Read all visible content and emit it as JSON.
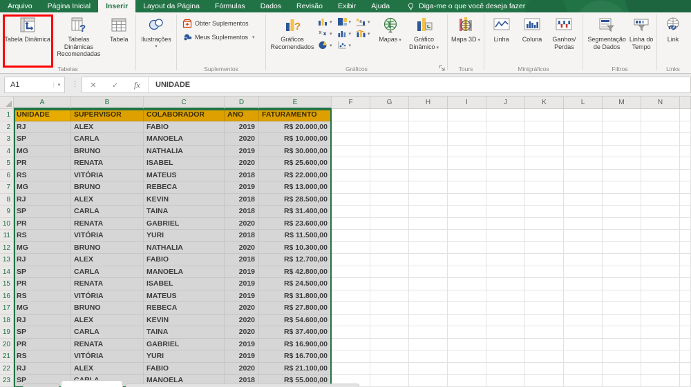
{
  "tabs": {
    "items": [
      {
        "label": "Arquivo",
        "active": false
      },
      {
        "label": "Página Inicial",
        "active": false
      },
      {
        "label": "Inserir",
        "active": true
      },
      {
        "label": "Layout da Página",
        "active": false
      },
      {
        "label": "Fórmulas",
        "active": false
      },
      {
        "label": "Dados",
        "active": false
      },
      {
        "label": "Revisão",
        "active": false
      },
      {
        "label": "Exibir",
        "active": false
      },
      {
        "label": "Ajuda",
        "active": false
      }
    ],
    "tell_me": "Diga-me o que você deseja fazer"
  },
  "ribbon": {
    "tabelas": {
      "group_label": "Tabelas",
      "pivot": "Tabela Dinâmica",
      "recommended": "Tabelas Dinâmicas Recomendadas",
      "table": "Tabela"
    },
    "ilustracoes": {
      "label": "Ilustrações"
    },
    "suplementos": {
      "group_label": "Suplementos",
      "get_addins": "Obter Suplementos",
      "my_addins": "Meus Suplementos"
    },
    "graficos": {
      "group_label": "Gráficos",
      "recommended": "Gráficos Recomendados",
      "mapas": "Mapas",
      "pivot_chart": "Gráfico Dinâmico"
    },
    "tours": {
      "group_label": "Tours",
      "map3d": "Mapa 3D"
    },
    "minigraficos": {
      "group_label": "Minigráficos",
      "linha": "Linha",
      "coluna": "Coluna",
      "ganhos_l1": "Ganhos/",
      "ganhos_l2": "Perdas"
    },
    "filtros": {
      "group_label": "Filtros",
      "slicer": "Segmentação de Dados",
      "timeline": "Linha do Tempo"
    },
    "links": {
      "group_label": "Links",
      "link": "Link"
    }
  },
  "formula_bar": {
    "name_box": "A1",
    "cancel_glyph": "✕",
    "enter_glyph": "✓",
    "fx_glyph": "fx",
    "formula": "UNIDADE"
  },
  "sheet": {
    "column_letters": [
      "A",
      "B",
      "C",
      "D",
      "E",
      "F",
      "G",
      "H",
      "I",
      "J",
      "K",
      "L",
      "M",
      "N"
    ],
    "selected_columns": [
      "A",
      "B",
      "C",
      "D",
      "E"
    ],
    "header_row": [
      "UNIDADE",
      "SUPERVISOR",
      "COLABORADOR",
      "ANO",
      "FATURAMENTO"
    ],
    "rows": [
      [
        "RJ",
        "ALEX",
        "FABIO",
        "2019",
        "R$ 20.000,00"
      ],
      [
        "SP",
        "CARLA",
        "MANOELA",
        "2020",
        "R$ 10.000,00"
      ],
      [
        "MG",
        "BRUNO",
        "NATHALIA",
        "2019",
        "R$ 30.000,00"
      ],
      [
        "PR",
        "RENATA",
        "ISABEL",
        "2020",
        "R$ 25.600,00"
      ],
      [
        "RS",
        "VITÓRIA",
        "MATEUS",
        "2018",
        "R$ 22.000,00"
      ],
      [
        "MG",
        "BRUNO",
        "REBECA",
        "2019",
        "R$ 13.000,00"
      ],
      [
        "RJ",
        "ALEX",
        "KEVIN",
        "2018",
        "R$ 28.500,00"
      ],
      [
        "SP",
        "CARLA",
        "TAINA",
        "2018",
        "R$ 31.400,00"
      ],
      [
        "PR",
        "RENATA",
        "GABRIEL",
        "2020",
        "R$ 23.600,00"
      ],
      [
        "RS",
        "VITÓRIA",
        "YURI",
        "2018",
        "R$ 11.500,00"
      ],
      [
        "MG",
        "BRUNO",
        "NATHALIA",
        "2020",
        "R$ 10.300,00"
      ],
      [
        "RJ",
        "ALEX",
        "FABIO",
        "2018",
        "R$ 12.700,00"
      ],
      [
        "SP",
        "CARLA",
        "MANOELA",
        "2019",
        "R$ 42.800,00"
      ],
      [
        "PR",
        "RENATA",
        "ISABEL",
        "2019",
        "R$ 24.500,00"
      ],
      [
        "RS",
        "VITÓRIA",
        "MATEUS",
        "2019",
        "R$ 31.800,00"
      ],
      [
        "MG",
        "BRUNO",
        "REBECA",
        "2020",
        "R$ 27.800,00"
      ],
      [
        "RJ",
        "ALEX",
        "KEVIN",
        "2020",
        "R$ 54.600,00"
      ],
      [
        "SP",
        "CARLA",
        "TAINA",
        "2020",
        "R$ 37.400,00"
      ],
      [
        "PR",
        "RENATA",
        "GABRIEL",
        "2019",
        "R$ 16.900,00"
      ],
      [
        "RS",
        "VITÓRIA",
        "YURI",
        "2019",
        "R$ 16.700,00"
      ],
      [
        "RJ",
        "ALEX",
        "FABIO",
        "2020",
        "R$ 21.100,00"
      ],
      [
        "SP",
        "CARLA",
        "MANOELA",
        "2018",
        "R$ 55.000,00"
      ]
    ]
  },
  "colors": {
    "excel_green": "#217346",
    "header_fill": "#dda000",
    "selection_fill": "#d6d6d6",
    "highlight_red": "#ff0000"
  }
}
